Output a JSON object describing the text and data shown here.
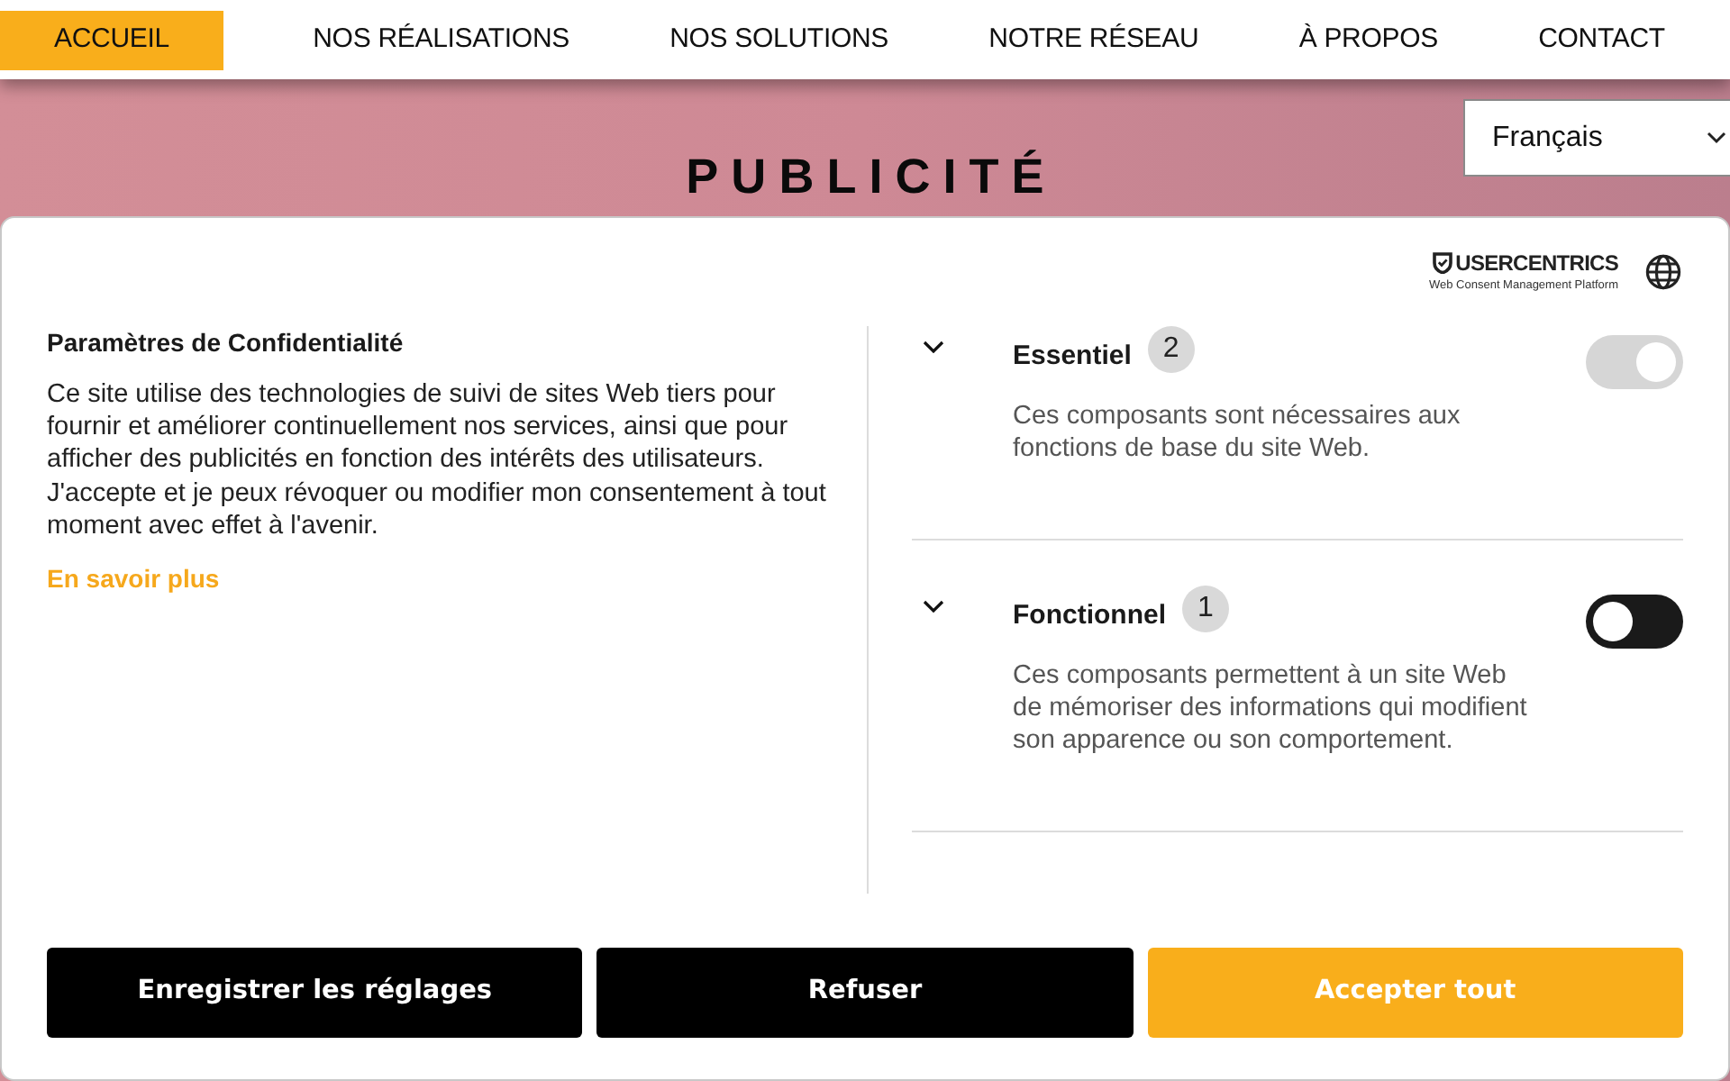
{
  "nav": {
    "items": [
      {
        "label": "ACCUEIL",
        "selected": true
      },
      {
        "label": "NOS RÉALISATIONS",
        "selected": false
      },
      {
        "label": "NOS SOLUTIONS",
        "selected": false
      },
      {
        "label": "NOTRE RÉSEAU",
        "selected": false
      },
      {
        "label": "À PROPOS",
        "selected": false
      },
      {
        "label": "CONTACT",
        "selected": false
      }
    ]
  },
  "hero": {
    "title": "PUBLICITÉ"
  },
  "language_select": {
    "value": "Français"
  },
  "consent_dialog": {
    "brand": {
      "name": "USERCENTRICS",
      "tagline": "Web Consent Management Platform"
    },
    "title": "Paramètres de Confidentialité",
    "description": "Ce site utilise des technologies de suivi de sites Web tiers pour fournir et améliorer continuellement nos services, ainsi que pour afficher des publicités en fonction des intérêts des utilisateurs. J'accepte et je peux révoquer ou modifier mon consentement à tout moment avec effet à l'avenir.",
    "learn_more": "En savoir plus",
    "categories": [
      {
        "name": "Essentiel",
        "count": "2",
        "description": "Ces composants sont nécessaires aux fonctions de base du site Web.",
        "on": true,
        "disabled": true
      },
      {
        "name": "Fonctionnel",
        "count": "1",
        "description": "Ces composants permettent à un site Web de mémoriser des informations qui modifient son apparence ou son comportement.",
        "on": false,
        "disabled": false
      }
    ],
    "buttons": [
      {
        "label": "Enregistrer les réglages",
        "kind": "secondary"
      },
      {
        "label": "Refuser",
        "kind": "secondary"
      },
      {
        "label": "Accepter tout",
        "kind": "primary"
      }
    ]
  }
}
